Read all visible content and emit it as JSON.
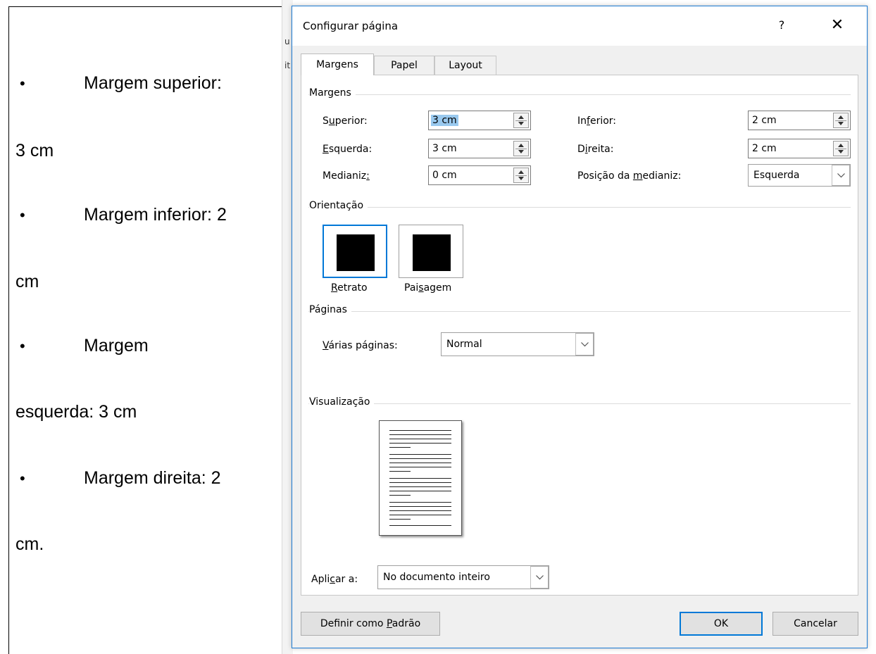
{
  "document": {
    "lines": [
      {
        "bullet": "•",
        "text": "Margem superior:"
      },
      {
        "bullet": "",
        "text": "3 cm"
      },
      {
        "bullet": "•",
        "text": "Margem inferior: 2"
      },
      {
        "bullet": "",
        "text": "cm"
      },
      {
        "bullet": "•",
        "text": "Margem"
      },
      {
        "bullet": "",
        "text": "esquerda: 3 cm"
      },
      {
        "bullet": "•",
        "text": "Margem direita: 2"
      },
      {
        "bullet": "",
        "text": "cm."
      }
    ],
    "edge_fragments": [
      "u",
      "it"
    ]
  },
  "dialog": {
    "title": "Configurar página",
    "help_glyph": "?",
    "close_glyph": "✕",
    "tabs": [
      {
        "label": "Margens",
        "active": true
      },
      {
        "label": "Papel",
        "active": false
      },
      {
        "label": "Layout",
        "active": false
      }
    ],
    "margins": {
      "section_label": "Margens",
      "top": {
        "label_pre": "S",
        "label_u": "u",
        "label_post": "perior:",
        "value": "3 cm"
      },
      "left": {
        "label_pre": "",
        "label_u": "E",
        "label_post": "squerda:",
        "value": "3 cm"
      },
      "gutter": {
        "label_pre": "Medianiz",
        "label_u": ":",
        "label_post": "",
        "value": "0 cm"
      },
      "bottom": {
        "label_pre": "In",
        "label_u": "f",
        "label_post": "erior:",
        "value": "2 cm"
      },
      "right": {
        "label_pre": "D",
        "label_u": "i",
        "label_post": "reita:",
        "value": "2 cm"
      },
      "gutter_position": {
        "label_pre": "Posição da ",
        "label_u": "m",
        "label_post": "edianiz:",
        "value": "Esquerda"
      }
    },
    "orientation": {
      "section_label": "Orientação",
      "portrait": {
        "label_u": "R",
        "label_post": "etrato",
        "selected": true
      },
      "landscape": {
        "label_pre": "Pai",
        "label_u": "s",
        "label_post": "agem",
        "selected": false
      }
    },
    "pages": {
      "section_label": "Páginas",
      "multiple_label_u": "V",
      "multiple_label_post": "árias páginas:",
      "multiple_value": "Normal"
    },
    "preview": {
      "section_label": "Visualização"
    },
    "apply_to": {
      "label_pre": "Apli",
      "label_u": "c",
      "label_post": "ar a:",
      "value": "No documento inteiro"
    },
    "buttons": {
      "set_default_pre": "Definir como ",
      "set_default_u": "P",
      "set_default_post": "adrão",
      "ok": "OK",
      "cancel": "Cancelar"
    },
    "accent_color": "#0078d7"
  }
}
